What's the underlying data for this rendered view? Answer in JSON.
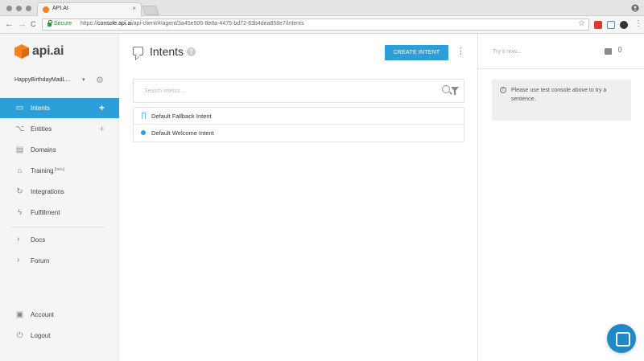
{
  "browser": {
    "tab_title": "API.AI",
    "tab_close": "×",
    "secure_label": "Secure",
    "url_prefix": "https://",
    "url_host": "console.api.ai",
    "url_path": "/api-client/#/agent/3a45e506-8e8a-4475-bd72-63b4dea858e7/intents",
    "back": "←",
    "forward": "→",
    "reload": "C",
    "bookmark_star": "☆"
  },
  "sidebar": {
    "logo_text": "api.ai",
    "agent_name": "HappyBirthdayMadL...",
    "agent_caret": "▾",
    "settings_glyph": "⚙",
    "items": [
      {
        "label": "Intents",
        "plus": "+",
        "glyph": "▭"
      },
      {
        "label": "Entities",
        "plus": "+",
        "glyph": "⌥"
      },
      {
        "label": "Domains",
        "glyph": "▤"
      },
      {
        "label": "Training",
        "beta": "[beta]",
        "glyph": "⌂"
      },
      {
        "label": "Integrations",
        "glyph": "↻"
      },
      {
        "label": "Fulfillment",
        "glyph": "ϟ"
      },
      {
        "label": "Docs",
        "glyph": "›"
      },
      {
        "label": "Forum",
        "glyph": "›"
      },
      {
        "label": "Account",
        "glyph": "▣"
      },
      {
        "label": "Logout",
        "glyph": "⏻"
      }
    ]
  },
  "main": {
    "title": "Intents",
    "help_glyph": "?",
    "create_button": "CREATE INTENT",
    "more_glyph": "⋮",
    "search_placeholder": "Search intents...",
    "intents": [
      {
        "label": "Default Fallback Intent"
      },
      {
        "label": "Default Welcome Intent"
      }
    ]
  },
  "console": {
    "try_placeholder": "Try it now...",
    "info_glyph": "!",
    "message": "Please use test console above to try a sentence."
  },
  "colors": {
    "accent": "#2d9fd8",
    "brand_orange": "#f58220",
    "sidebar_bg": "#f5f5f5"
  },
  "icons": {
    "page_title_icon": "chat-bubble-icon",
    "search": "search-icon",
    "filter": "filter-icon",
    "support": "chat-support-icon"
  }
}
